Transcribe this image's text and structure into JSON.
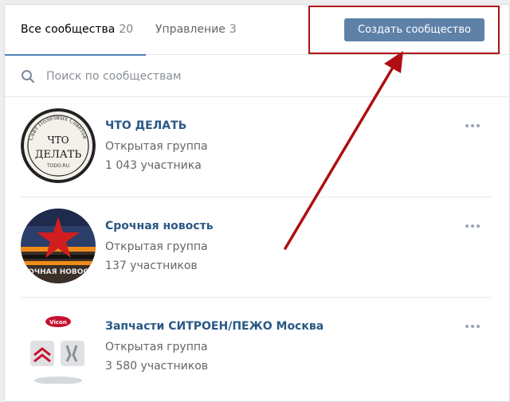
{
  "tabs": [
    {
      "label": "Все сообщества",
      "count": "20"
    },
    {
      "label": "Управление",
      "count": "3"
    }
  ],
  "create_button": "Создать сообщество",
  "search": {
    "placeholder": "Поиск по сообществам"
  },
  "communities": [
    {
      "name": "ЧТО ДЕЛАТЬ",
      "type": "Открытая группа",
      "members": "1 043 участника",
      "avatar_text": [
        "Сайт Полезных Советов",
        "ЧТО",
        "ДЕЛАТЬ",
        "TODO.RU"
      ]
    },
    {
      "name": "Срочная новость",
      "type": "Открытая группа",
      "members": "137 участников",
      "avatar_text": [
        "СРОЧНАЯ НОВОСТЬ"
      ]
    },
    {
      "name": "Запчасти СИТРОЕН/ПЕЖО Москва",
      "type": "Открытая группа",
      "members": "3 580 участников",
      "avatar_text": [
        "Vicon"
      ]
    }
  ],
  "colors": {
    "accent": "#5181b8",
    "button": "#5e81a8",
    "link": "#2a5885",
    "annotation": "#b00d13"
  }
}
